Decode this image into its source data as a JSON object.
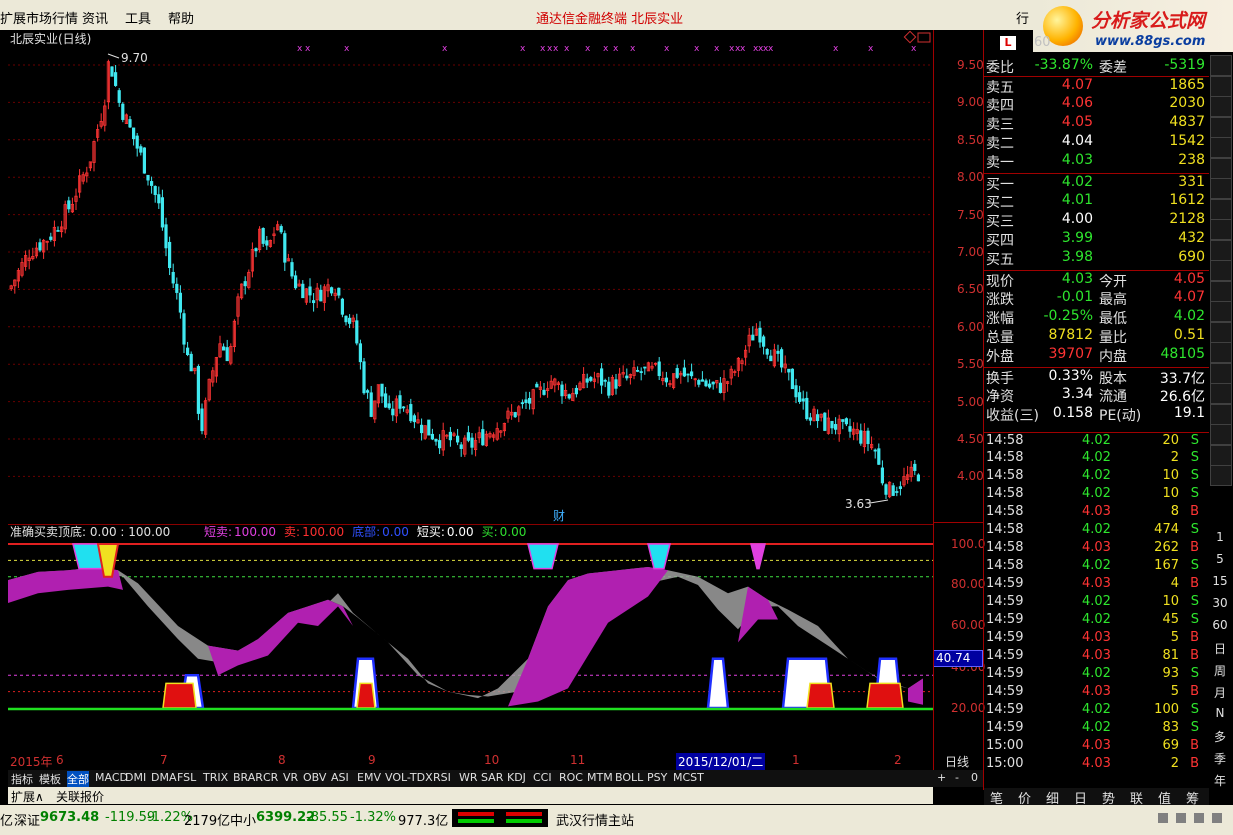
{
  "menu": {
    "items": [
      "扩展市场行情",
      "资讯",
      "工具",
      "帮助"
    ],
    "center_title": "通达信金融终端    北辰实业",
    "right_label": "行"
  },
  "logo": {
    "title": "分析家公式网",
    "url_text": "www.88gs.com"
  },
  "main_chart": {
    "title": "北辰实业(日线)",
    "high_label": "9.70",
    "low_label": "3.63",
    "cai_label": "财",
    "flag_label": "L"
  },
  "price_axis": [
    "9.50",
    "9.00",
    "8.50",
    "8.00",
    "7.50",
    "7.00",
    "6.50",
    "6.00",
    "5.50",
    "5.00",
    "4.50",
    "4.00"
  ],
  "indicator": {
    "name": "准确买卖顶底",
    "params": ": 0.00 : 100.00",
    "items": [
      {
        "label": "短卖:",
        "value": "100.00",
        "color": "#e040e0"
      },
      {
        "label": "卖:",
        "value": "100.00",
        "color": "#ff3030"
      },
      {
        "label": "底部:",
        "value": "0.00",
        "color": "#3050ff"
      },
      {
        "label": "短买:",
        "value": "0.00",
        "color": "#ffffff"
      },
      {
        "label": "买:",
        "value": "0.00",
        "color": "#30e030"
      }
    ],
    "axis": [
      "100.0",
      "80.00",
      "60.00",
      "40.00",
      "20.00"
    ],
    "current_value": "40.74"
  },
  "date_axis": {
    "labels": [
      "2015年",
      "6",
      "7",
      "8",
      "9",
      "10",
      "11",
      "2015/12/01/二",
      "1",
      "2"
    ],
    "period": "日线",
    "controls": [
      "+",
      "-",
      "0"
    ]
  },
  "tabs": [
    "指标",
    "模板",
    "全部",
    "MACD",
    "DMI",
    "DMA",
    "FSL",
    "TRIX",
    "BRAR",
    "CR",
    "VR",
    "OBV",
    "ASI",
    "EMV",
    "VOL-TDX",
    "RSI",
    "WR",
    "SAR",
    "KDJ",
    "CCI",
    "ROC",
    "MTM",
    "BOLL",
    "PSY",
    "MCST"
  ],
  "subtabs": [
    "扩展∧",
    "关联报价"
  ],
  "quote": {
    "code": "60",
    "webi": {
      "label": "委比",
      "value": "-33.87%",
      "label2": "委差",
      "value2": "-5319"
    },
    "sells": [
      {
        "label": "卖五",
        "price": "4.07",
        "vol": "1865"
      },
      {
        "label": "卖四",
        "price": "4.06",
        "vol": "2030"
      },
      {
        "label": "卖三",
        "price": "4.05",
        "vol": "4837"
      },
      {
        "label": "卖二",
        "price": "4.04",
        "vol": "1542"
      },
      {
        "label": "卖一",
        "price": "4.03",
        "vol": "238"
      }
    ],
    "buys": [
      {
        "label": "买一",
        "price": "4.02",
        "vol": "331"
      },
      {
        "label": "买二",
        "price": "4.01",
        "vol": "1612"
      },
      {
        "label": "买三",
        "price": "4.00",
        "vol": "2128"
      },
      {
        "label": "买四",
        "price": "3.99",
        "vol": "432"
      },
      {
        "label": "买五",
        "price": "3.98",
        "vol": "690"
      }
    ],
    "stats": [
      {
        "l1": "现价",
        "v1": "4.03",
        "l2": "今开",
        "v2": "4.05"
      },
      {
        "l1": "涨跌",
        "v1": "-0.01",
        "l2": "最高",
        "v2": "4.07"
      },
      {
        "l1": "涨幅",
        "v1": "-0.25%",
        "l2": "最低",
        "v2": "4.02"
      },
      {
        "l1": "总量",
        "v1": "87812",
        "l2": "量比",
        "v2": "0.51"
      },
      {
        "l1": "外盘",
        "v1": "39707",
        "l2": "内盘",
        "v2": "48105"
      }
    ],
    "stats2": [
      {
        "l1": "换手",
        "v1": "0.33%",
        "l2": "股本",
        "v2": "33.7亿"
      },
      {
        "l1": "净资",
        "v1": "3.34",
        "l2": "流通",
        "v2": "26.6亿"
      },
      {
        "l1": "收益(三)",
        "v1": "0.158",
        "l2": "PE(动)",
        "v2": "19.1"
      }
    ]
  },
  "ticks": [
    {
      "t": "14:58",
      "p": "4.02",
      "v": "20",
      "s": "S"
    },
    {
      "t": "14:58",
      "p": "4.02",
      "v": "2",
      "s": "S"
    },
    {
      "t": "14:58",
      "p": "4.02",
      "v": "10",
      "s": "S"
    },
    {
      "t": "14:58",
      "p": "4.02",
      "v": "10",
      "s": "S"
    },
    {
      "t": "14:58",
      "p": "4.03",
      "v": "8",
      "s": "B"
    },
    {
      "t": "14:58",
      "p": "4.02",
      "v": "474",
      "s": "S"
    },
    {
      "t": "14:58",
      "p": "4.03",
      "v": "262",
      "s": "B"
    },
    {
      "t": "14:58",
      "p": "4.02",
      "v": "167",
      "s": "S"
    },
    {
      "t": "14:59",
      "p": "4.03",
      "v": "4",
      "s": "B"
    },
    {
      "t": "14:59",
      "p": "4.02",
      "v": "10",
      "s": "S"
    },
    {
      "t": "14:59",
      "p": "4.02",
      "v": "45",
      "s": "S"
    },
    {
      "t": "14:59",
      "p": "4.03",
      "v": "5",
      "s": "B"
    },
    {
      "t": "14:59",
      "p": "4.03",
      "v": "81",
      "s": "B"
    },
    {
      "t": "14:59",
      "p": "4.02",
      "v": "93",
      "s": "S"
    },
    {
      "t": "14:59",
      "p": "4.03",
      "v": "5",
      "s": "B"
    },
    {
      "t": "14:59",
      "p": "4.02",
      "v": "100",
      "s": "S"
    },
    {
      "t": "14:59",
      "p": "4.02",
      "v": "83",
      "s": "S"
    },
    {
      "t": "15:00",
      "p": "4.03",
      "v": "69",
      "s": "B"
    },
    {
      "t": "15:00",
      "p": "4.03",
      "v": "2",
      "s": "B"
    }
  ],
  "bottom_tabs": [
    "笔",
    "价",
    "细",
    "日",
    "势",
    "联",
    "值",
    "筹"
  ],
  "tool_labels": [
    "1",
    "5",
    "15",
    "30",
    "60",
    "日",
    "周",
    "月",
    "N",
    "多",
    "季",
    "年"
  ],
  "status": {
    "left_char": "亿",
    "sz_label": "深证",
    "sz_value": "9673.48",
    "sz_change": "-119.59",
    "sz_pct": "-1.22%",
    "sz_amount": "2179亿",
    "zx_label": "中小",
    "zx_value": "6399.22",
    "zx_change": "-85.55",
    "zx_pct": "-1.32%",
    "zx_amount": "977.3亿",
    "server": "武汉行情主站"
  },
  "colors": {
    "up": "#ff3434",
    "down": "#40e8f0",
    "bg": "#000000",
    "grid": "#8a0000"
  }
}
